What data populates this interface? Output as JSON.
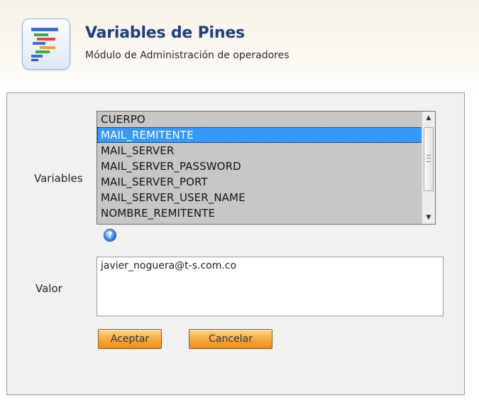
{
  "header": {
    "title": "Variables de Pines",
    "subtitle": "Módulo de Administración de operadores",
    "app_icon": "list-tree-icon"
  },
  "form": {
    "variables_label": "Variables",
    "valor_label": "Valor",
    "variables_list": {
      "items": [
        "CUERPO",
        "MAIL_REMITENTE",
        "MAIL_SERVER",
        "MAIL_SERVER_PASSWORD",
        "MAIL_SERVER_PORT",
        "MAIL_SERVER_USER_NAME",
        "NOMBRE_REMITENTE"
      ],
      "selected": "MAIL_REMITENTE"
    },
    "help_icon": "help-icon",
    "help_icon_glyph": "?",
    "valor_value": "javier_noguera@t-s.com.co",
    "scroll_up_glyph": "▲",
    "scroll_down_glyph": "▼"
  },
  "buttons": {
    "accept_label": "Aceptar",
    "cancel_label": "Cancelar"
  },
  "colors": {
    "title": "#1f3f7a",
    "selection": "#3399ff",
    "button_fill": "#f7a73b",
    "panel_background": "#f1f1f1"
  }
}
